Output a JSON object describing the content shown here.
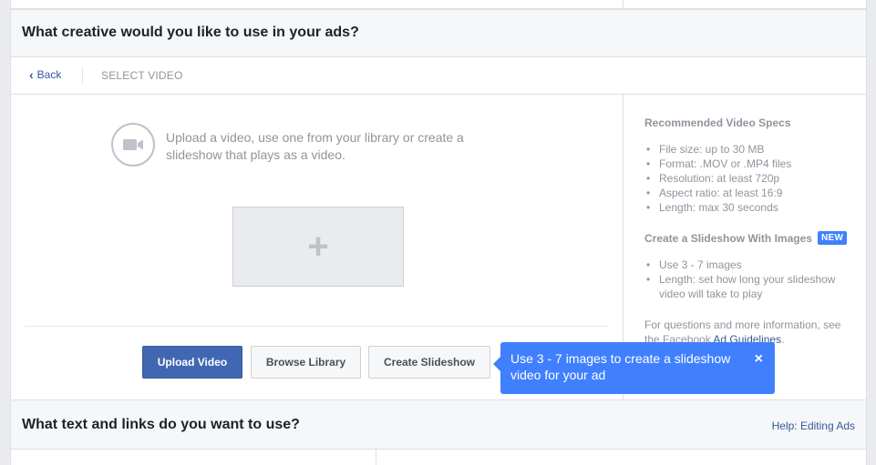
{
  "creative_section": {
    "title": "What creative would you like to use in your ads?"
  },
  "nav": {
    "back_label": "Back",
    "step_label": "SELECT VIDEO"
  },
  "upload": {
    "intro_text": "Upload a video, use one from your library or create a slideshow that plays as a video.",
    "plus_glyph": "+"
  },
  "buttons": {
    "upload_video": "Upload Video",
    "browse_library": "Browse Library",
    "create_slideshow": "Create Slideshow"
  },
  "tooltip": {
    "text": "Use 3 - 7 images to create a slideshow video for your ad",
    "close_glyph": "×"
  },
  "specs": {
    "video_title": "Recommended Video Specs",
    "video_items": [
      "File size: up to 30 MB",
      "Format: .MOV or .MP4 files",
      "Resolution: at least 720p",
      "Aspect ratio: at least 16:9",
      "Length: max 30 seconds"
    ],
    "slideshow_title": "Create a Slideshow With Images",
    "new_badge": "NEW",
    "slideshow_items": [
      "Use 3 - 7 images",
      "Length: set how long your slideshow video will take to play"
    ],
    "footer_prefix": "For questions and more information, see the Facebook ",
    "footer_link": "Ad Guidelines",
    "footer_suffix": "."
  },
  "text_section": {
    "title": "What text and links do you want to use?",
    "help_link": "Help: Editing Ads"
  },
  "colors": {
    "primary": "#4267b2",
    "tooltip_bg": "#4080ff",
    "link": "#365899"
  },
  "icons": {
    "back": "chevron-left-icon",
    "camera": "video-camera-icon",
    "plus": "plus-icon",
    "close": "close-icon"
  }
}
